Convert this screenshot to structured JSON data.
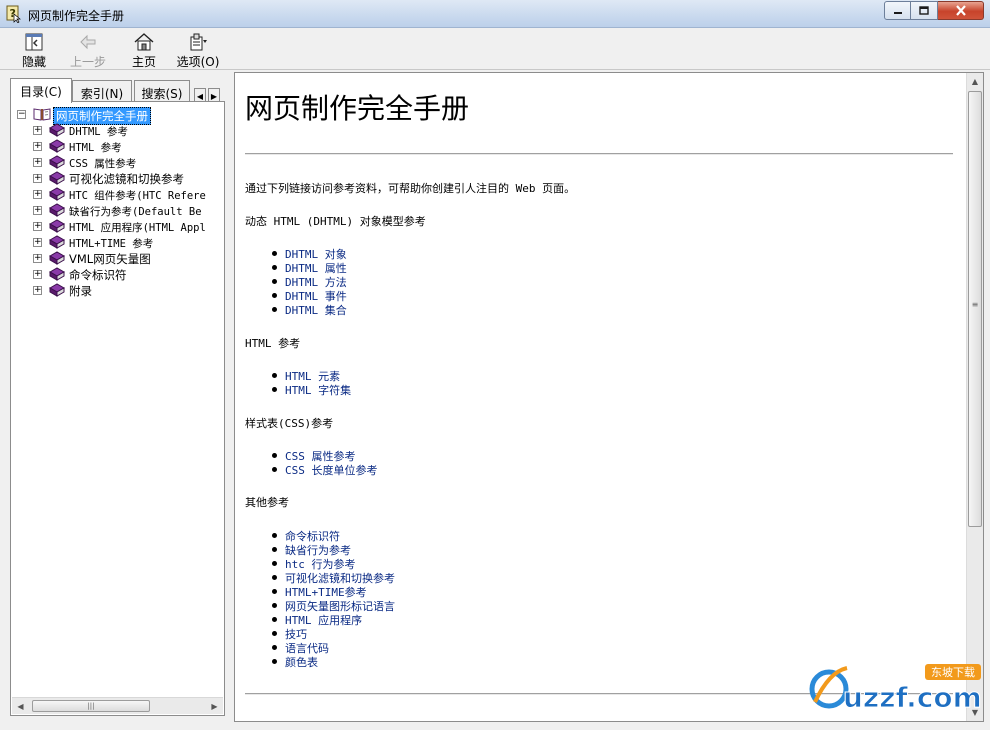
{
  "window": {
    "title": "网页制作完全手册"
  },
  "toolbar": {
    "hide_label": "隐藏",
    "back_label": "上一步",
    "home_label": "主页",
    "options_label": "选项(O)"
  },
  "tabs": [
    {
      "label": "目录(C)"
    },
    {
      "label": "索引(N)"
    },
    {
      "label": "搜索(S)"
    }
  ],
  "tree": {
    "root": "网页制作完全手册",
    "items": [
      "DHTML 参考",
      "HTML 参考",
      "CSS 属性参考",
      "可视化滤镜和切换参考",
      "HTC 组件参考(HTC Refere",
      "缺省行为参考(Default Be",
      "HTML 应用程序(HTML Appl",
      "HTML+TIME 参考",
      "VML网页矢量图",
      "命令标识符",
      "附录"
    ]
  },
  "content": {
    "title": "网页制作完全手册",
    "intro": "通过下列链接访问参考资料，可帮助你创建引人注目的 Web 页面。",
    "sections": [
      {
        "heading": "动态 HTML (DHTML) 对象模型参考",
        "links": [
          "DHTML 对象",
          "DHTML 属性",
          "DHTML 方法",
          "DHTML 事件",
          "DHTML 集合"
        ]
      },
      {
        "heading": "HTML 参考",
        "links": [
          "HTML 元素",
          "HTML 字符集"
        ]
      },
      {
        "heading": "样式表(CSS)参考",
        "links": [
          "CSS 属性参考",
          "CSS 长度单位参考"
        ]
      },
      {
        "heading": "其他参考",
        "links": [
          "命令标识符",
          "缺省行为参考",
          "htc 行为参考",
          "可视化滤镜和切换参考",
          "HTML+TIME参考",
          "网页矢量图形标记语言",
          "HTML 应用程序",
          "技巧",
          "语言代码",
          "颜色表"
        ]
      }
    ]
  },
  "watermark": {
    "brand": "uzzf.com",
    "tag": "东坡下载"
  },
  "colors": {
    "link": "#0a2a84",
    "selection": "#3399ff",
    "book": "#6a2a8c"
  }
}
